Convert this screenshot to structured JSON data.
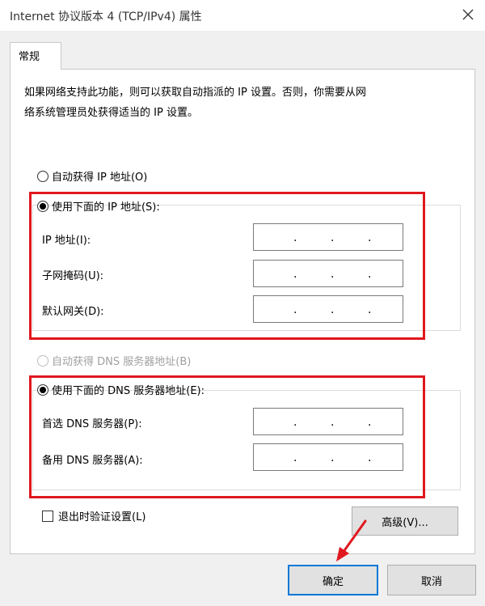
{
  "window": {
    "title": "Internet 协议版本 4 (TCP/IPv4) 属性"
  },
  "icons": {
    "close": "close-icon",
    "arrow": "red-arrow-annotation"
  },
  "tabs": [
    {
      "label": "常规"
    }
  ],
  "description": {
    "line1": "如果网络支持此功能，则可以获取自动指派的 IP 设置。否则，你需要从网",
    "line2": "络系统管理员处获得适当的 IP 设置。"
  },
  "ip_section": {
    "auto_label": "自动获得 IP 地址(O)",
    "manual_label": "使用下面的 IP 地址(S):",
    "fields": [
      {
        "label": "IP 地址(I):",
        "value": ". . ."
      },
      {
        "label": "子网掩码(U):",
        "value": ". . ."
      },
      {
        "label": "默认网关(D):",
        "value": ". . ."
      }
    ]
  },
  "dns_section": {
    "auto_label": "自动获得 DNS 服务器地址(B)",
    "manual_label": "使用下面的 DNS 服务器地址(E):",
    "fields": [
      {
        "label": "首选 DNS 服务器(P):",
        "value": ". . ."
      },
      {
        "label": "备用 DNS 服务器(A):",
        "value": ". . ."
      }
    ]
  },
  "validate_label": "退出时验证设置(L)",
  "buttons": {
    "advanced": "高级(V)...",
    "ok": "确定",
    "cancel": "取消"
  },
  "colors": {
    "annotation_red": "#e0181f",
    "default_button_border": "#0078d7"
  }
}
